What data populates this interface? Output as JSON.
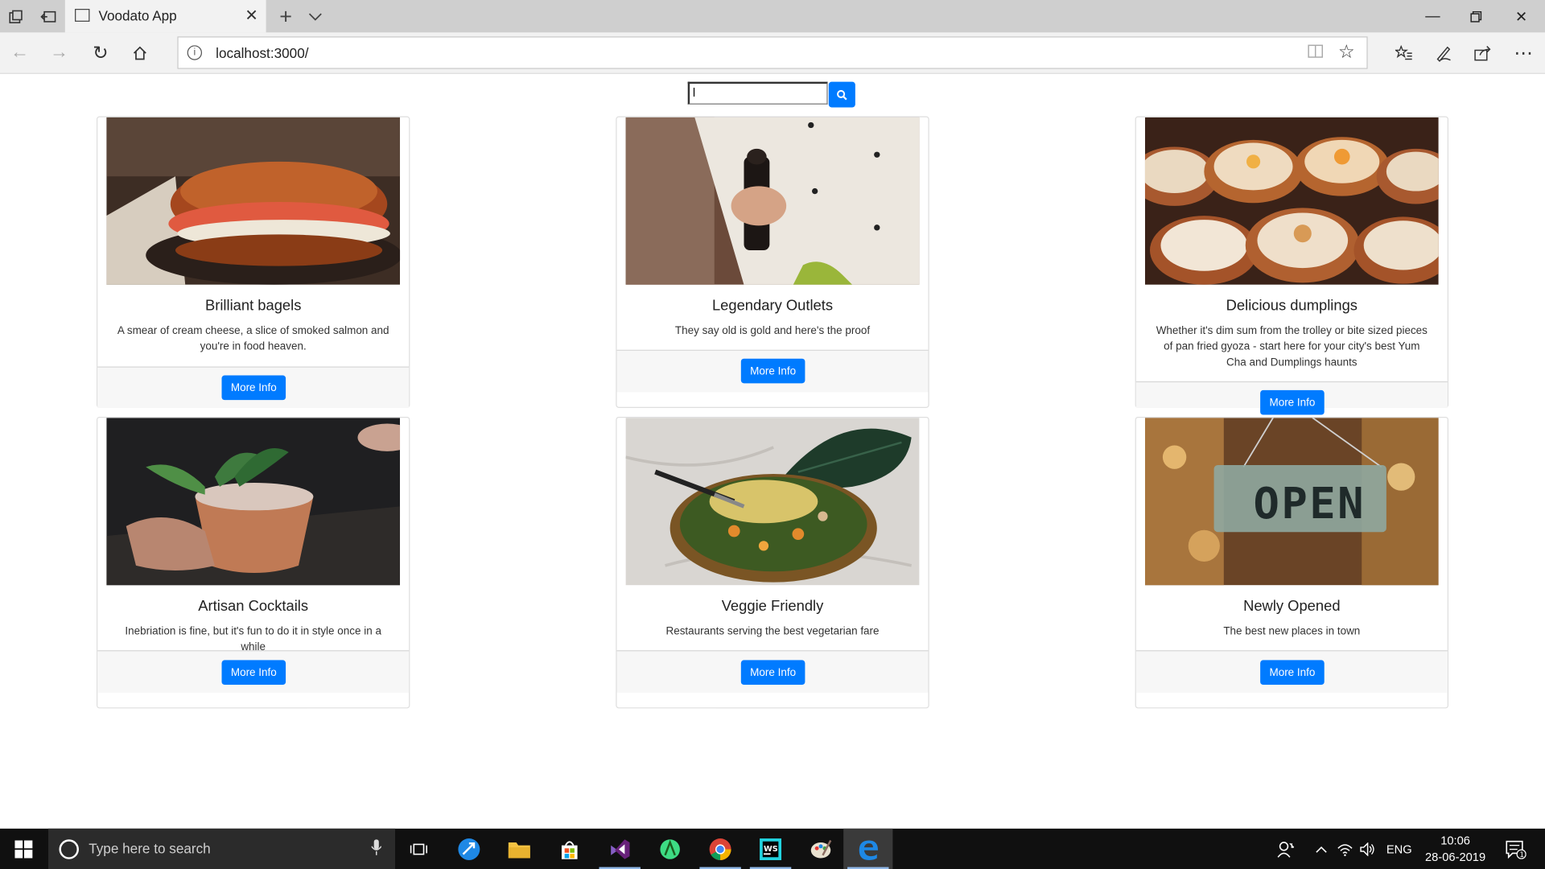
{
  "browser": {
    "tab_title": "Voodato App",
    "url": "localhost:3000/"
  },
  "search": {
    "value": "l",
    "placeholder": ""
  },
  "cards": [
    {
      "title": "Brilliant bagels",
      "description": "A smear of cream cheese, a slice of smoked salmon and you're in food heaven.",
      "button": "More Info",
      "image": "bagel-photo"
    },
    {
      "title": "Legendary Outlets",
      "description": "They say old is gold and here's the proof",
      "button": "More Info",
      "image": "chef-pepper-photo"
    },
    {
      "title": "Delicious dumplings",
      "description": "Whether it's dim sum from the trolley or bite sized pieces of pan fried gyoza - start here for your city's best Yum Cha and Dumplings haunts",
      "button": "More Info",
      "image": "dumplings-photo"
    },
    {
      "title": "Artisan Cocktails",
      "description": "Inebriation is fine, but it's fun to do it in style once in a while",
      "button": "More Info",
      "image": "cocktail-photo"
    },
    {
      "title": "Veggie Friendly",
      "description": "Restaurants serving the best vegetarian fare",
      "button": "More Info",
      "image": "veggie-bowl-photo"
    },
    {
      "title": "Newly Opened",
      "description": "The best new places in town",
      "button": "More Info",
      "image": "open-sign-photo"
    }
  ],
  "open_sign_text": "OPEN",
  "taskbar": {
    "search_placeholder": "Type here to search",
    "language": "ENG",
    "time": "10:06",
    "date": "28-06-2019",
    "notification_count": "1"
  },
  "colors": {
    "primary": "#007bff",
    "taskbar": "#101010",
    "tabbar": "#cfcfcf"
  }
}
